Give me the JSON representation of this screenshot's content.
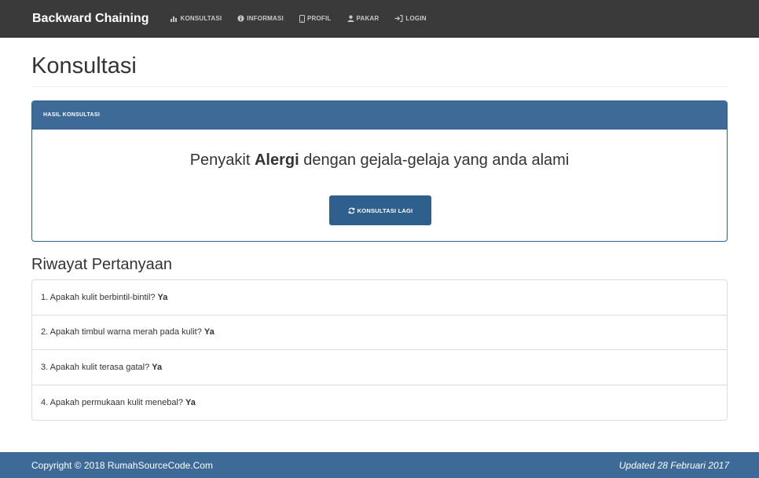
{
  "navbar": {
    "brand": "Backward Chaining",
    "items": [
      {
        "label": "KONSULTASI",
        "icon": "bar-chart-icon"
      },
      {
        "label": "INFORMASI",
        "icon": "info-circle-icon"
      },
      {
        "label": "PROFIL",
        "icon": "phone-icon"
      },
      {
        "label": "PAKAR",
        "icon": "user-icon"
      },
      {
        "label": "LOGIN",
        "icon": "login-icon"
      }
    ]
  },
  "page": {
    "title": "Konsultasi"
  },
  "panel": {
    "heading": "HASIL KONSULTASI",
    "result_prefix": "Penyakit",
    "disease": "Alergi",
    "result_suffix": "dengan gejala-gelaja yang anda alami",
    "button_label": "KONSULTASI LAGI",
    "button_icon": "refresh-icon"
  },
  "history": {
    "title": "Riwayat Pertanyaan",
    "items": [
      {
        "question": "1. Apakah kulit berbintil-bintil?",
        "answer": "Ya"
      },
      {
        "question": "2. Apakah timbul warna merah pada kulit?",
        "answer": "Ya"
      },
      {
        "question": "3. Apakah kulit terasa gatal?",
        "answer": "Ya"
      },
      {
        "question": "4. Apakah permukaan kulit menebal?",
        "answer": "Ya"
      }
    ]
  },
  "footer": {
    "copyright": "Copyright © 2018 RumahSourceCode.Com",
    "updated": "Updated 28 Februari 2017"
  },
  "colors": {
    "navbar_bg": "#3a3a3a",
    "primary": "#3d6a96",
    "button": "#2f5f8c"
  }
}
